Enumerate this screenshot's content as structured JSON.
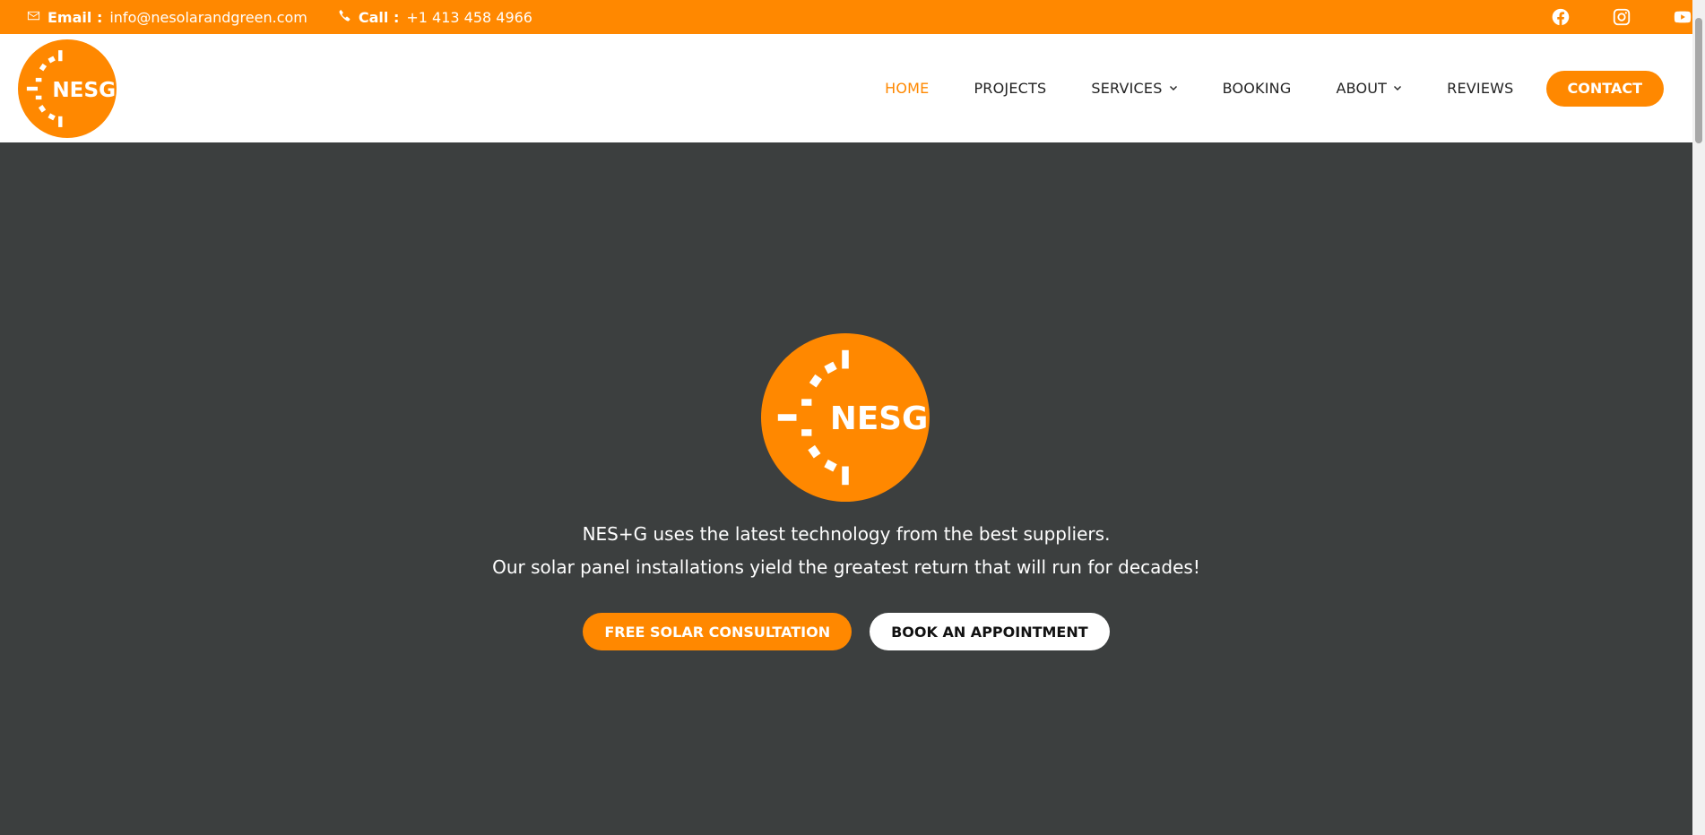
{
  "topbar": {
    "email_label": "Email :",
    "email_value": "info@nesolarandgreen.com",
    "call_label": "Call :",
    "call_value": "+1 413 458 4966",
    "social": [
      "facebook-icon",
      "instagram-icon",
      "youtube-icon"
    ]
  },
  "header": {
    "logo_text": "NESG",
    "nav": {
      "home": "HOME",
      "projects": "PROJECTS",
      "services": "SERVICES",
      "booking": "BOOKING",
      "about": "ABOUT",
      "reviews": "REVIEWS",
      "contact": "CONTACT"
    }
  },
  "hero": {
    "logo_text": "NESG",
    "line1": "NES+G uses the latest technology from the best suppliers.",
    "line2": "Our solar panel installations yield the greatest return that will run for decades!",
    "primary_button": "FREE SOLAR CONSULTATION",
    "secondary_button": "BOOK AN APPOINTMENT"
  },
  "colors": {
    "brand_orange": "#ff8800",
    "hero_background": "#3c3f3f",
    "header_background": "#ffffff"
  }
}
